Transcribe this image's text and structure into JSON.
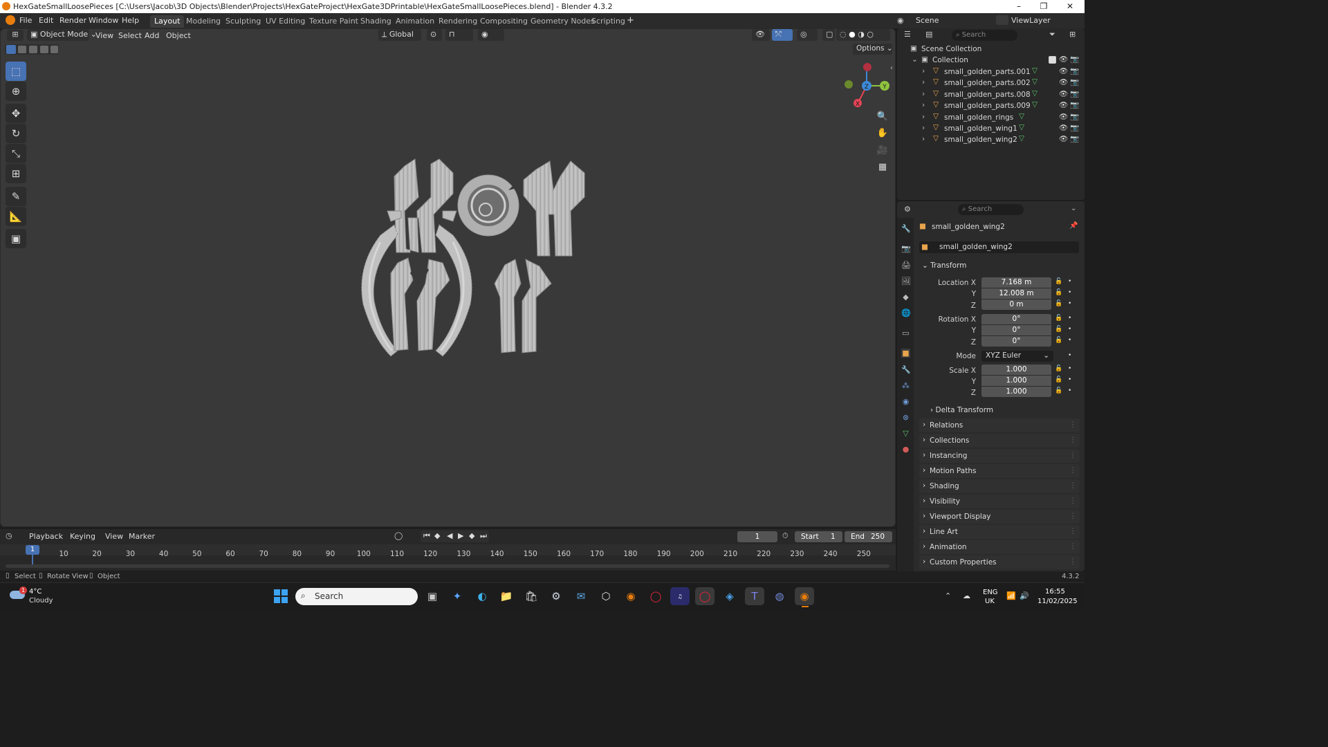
{
  "window": {
    "title": "HexGateSmallLoosePieces [C:\\Users\\Jacob\\3D Objects\\Blender\\Projects\\HexGateProject\\HexGate3DPrintable\\HexGateSmallLoosePieces.blend] - Blender 4.3.2",
    "minimize": "–",
    "maximize": "❐",
    "close": "✕"
  },
  "menu": [
    "File",
    "Edit",
    "Render",
    "Window",
    "Help"
  ],
  "workspaces": [
    {
      "label": "Layout",
      "active": true
    },
    {
      "label": "Modeling"
    },
    {
      "label": "Sculpting"
    },
    {
      "label": "UV Editing"
    },
    {
      "label": "Texture Paint"
    },
    {
      "label": "Shading"
    },
    {
      "label": "Animation"
    },
    {
      "label": "Rendering"
    },
    {
      "label": "Compositing"
    },
    {
      "label": "Geometry Nodes"
    },
    {
      "label": "Scripting"
    }
  ],
  "add_workspace": "+",
  "scene": {
    "label": "Scene",
    "viewlayer": "ViewLayer"
  },
  "viewport": {
    "mode": "Object Mode",
    "menus": [
      "View",
      "Select",
      "Add",
      "Object"
    ],
    "orientation": "Global",
    "options": "Options",
    "gizmo": {
      "x": "X",
      "y": "Y",
      "z": "Z"
    }
  },
  "outliner": {
    "search_placeholder": "Search",
    "scene_collection": "Scene Collection",
    "collection": "Collection",
    "objects": [
      "small_golden_parts.001",
      "small_golden_parts.002",
      "small_golden_parts.008",
      "small_golden_parts.009",
      "small_golden_rings",
      "small_golden_wing1",
      "small_golden_wing2"
    ]
  },
  "properties": {
    "search_placeholder": "Search",
    "object_name": "small_golden_wing2",
    "datablock": "small_golden_wing2",
    "transform": {
      "title": "Transform",
      "location_label": "Location X",
      "loc_x": "7.168 m",
      "loc_y": "12.008 m",
      "loc_z": "0 m",
      "rotation_label": "Rotation X",
      "rot_x": "0°",
      "rot_y": "0°",
      "rot_z": "0°",
      "mode_label": "Mode",
      "mode": "XYZ Euler",
      "scale_label": "Scale X",
      "scale_x": "1.000",
      "scale_y": "1.000",
      "scale_z": "1.000",
      "y": "Y",
      "z": "Z"
    },
    "delta": "Delta Transform",
    "panels": [
      "Relations",
      "Collections",
      "Instancing",
      "Motion Paths",
      "Shading",
      "Visibility",
      "Viewport Display",
      "Line Art",
      "Animation",
      "Custom Properties"
    ]
  },
  "timeline": {
    "menus": [
      "Playback",
      "Keying",
      "View",
      "Marker"
    ],
    "current_frame": "1",
    "start_label": "Start",
    "start": "1",
    "end_label": "End",
    "end": "250",
    "ticks": [
      "10",
      "20",
      "30",
      "40",
      "50",
      "60",
      "70",
      "80",
      "90",
      "100",
      "110",
      "120",
      "130",
      "140",
      "150",
      "160",
      "170",
      "180",
      "190",
      "200",
      "210",
      "220",
      "230",
      "240",
      "250"
    ],
    "playhead": "1"
  },
  "status": {
    "select": "Select",
    "rotate": "Rotate View",
    "object": "Object",
    "version": "4.3.2"
  },
  "taskbar": {
    "weather_temp": "4°C",
    "weather_desc": "Cloudy",
    "weather_badge": "1",
    "search_placeholder": "Search",
    "lang": "ENG",
    "region": "UK",
    "time": "16:55",
    "date": "11/02/2025"
  }
}
